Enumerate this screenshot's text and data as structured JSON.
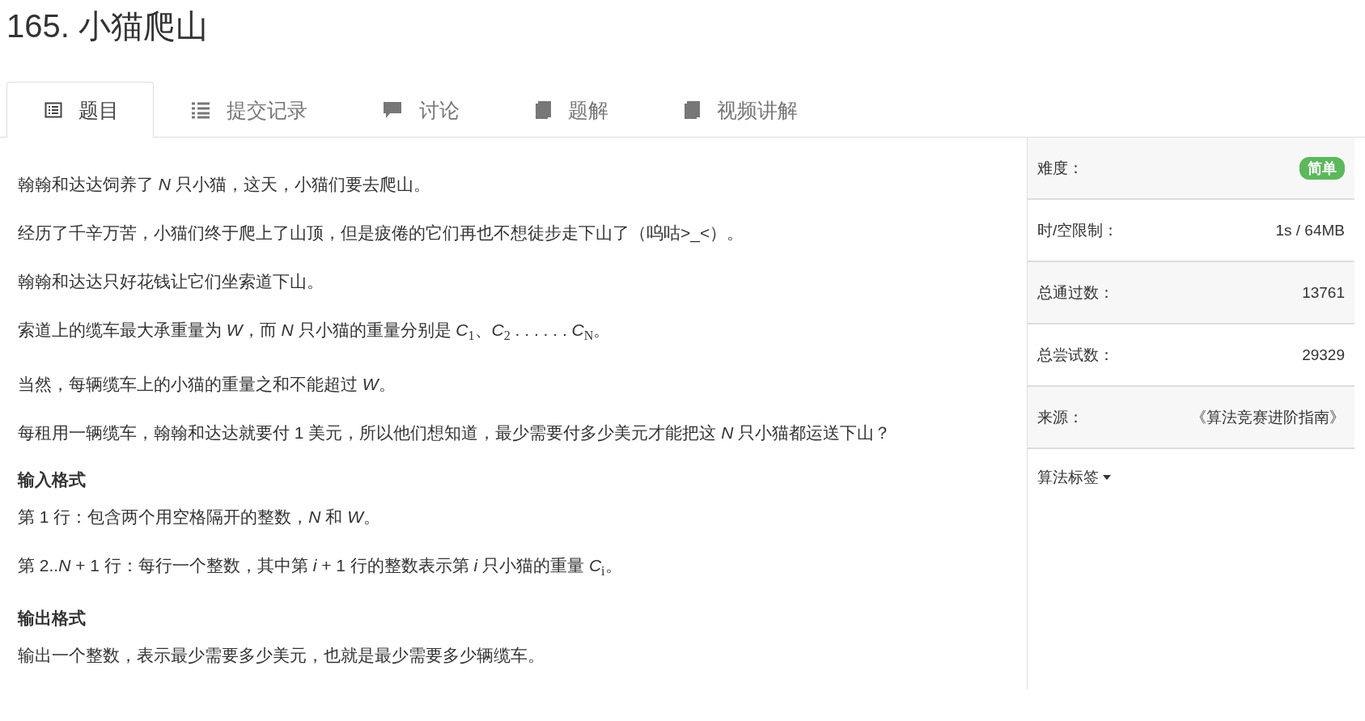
{
  "title": "165. 小猫爬山",
  "tabs": [
    {
      "label": "题目",
      "selected": true
    },
    {
      "label": "提交记录",
      "selected": false
    },
    {
      "label": "讨论",
      "selected": false
    },
    {
      "label": "题解",
      "selected": false
    },
    {
      "label": "视频讲解",
      "selected": false
    }
  ],
  "content": [
    {
      "kind": "text",
      "text": "翰翰和达达饲养了 *N* 只小猫，这天，小猫们要去爬山。"
    },
    {
      "kind": "text",
      "text": "经历了千辛万苦，小猫们终于爬上了山顶，但是疲倦的它们再也不想徒步走下山了（呜咕>_<）。"
    },
    {
      "kind": "text",
      "text": "翰翰和达达只好花钱让它们坐索道下山。"
    },
    {
      "kind": "text",
      "text": "索道上的缆车最大承重量为 *W*，而 *N* 只小猫的重量分别是 *C*$_{1}$、*C*$_{2}$ . . . . . . *C*$_{N}$。"
    },
    {
      "kind": "text",
      "text": "当然，每辆缆车上的小猫的重量之和不能超过 *W*。"
    },
    {
      "kind": "text",
      "text": "每租用一辆缆车，翰翰和达达就要付 1 美元，所以他们想知道，最少需要付多少美元才能把这 *N* 只小猫都运送下山？"
    },
    {
      "kind": "heading",
      "text": "输入格式"
    },
    {
      "kind": "text",
      "text": "第 1 行：包含两个用空格隔开的整数，*N* 和 *W*。"
    },
    {
      "kind": "text",
      "text": "第 2..*N* + 1 行：每行一个整数，其中第 *i* + 1 行的整数表示第 *i* 只小猫的重量 *C*$_{i}$。"
    },
    {
      "kind": "heading",
      "text": "输出格式"
    },
    {
      "kind": "text",
      "text": "输出一个整数，表示最少需要多少美元，也就是最少需要多少辆缆车。"
    }
  ],
  "sidebar": {
    "rows": [
      {
        "label": "难度：",
        "value": "简单",
        "kind": "badge",
        "color": "#5cb85c"
      },
      {
        "label": "时/空限制：",
        "value": "1s / 64MB",
        "kind": "text"
      },
      {
        "label": "总通过数：",
        "value": "13761",
        "kind": "text"
      },
      {
        "label": "总尝试数：",
        "value": "29329",
        "kind": "text"
      },
      {
        "label": "来源：",
        "value": "《算法竞赛进阶指南》",
        "kind": "text"
      }
    ],
    "tags_toggle": {
      "label": "算法标签",
      "expanded": false
    }
  }
}
